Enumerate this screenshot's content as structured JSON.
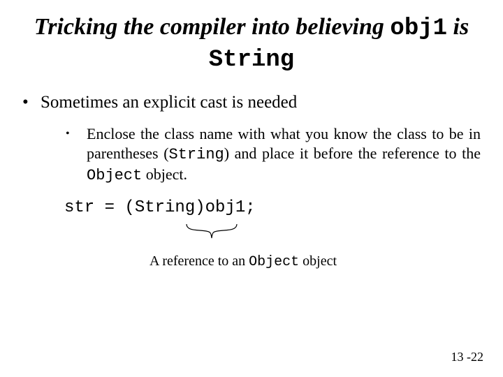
{
  "title": {
    "pre": "Tricking the compiler into believing ",
    "code1": "obj1",
    "mid": " is ",
    "code2": "String"
  },
  "point1": "Sometimes an explicit cast is needed",
  "sub1": {
    "a": "Enclose the class name with what you know the class to be in parentheses (",
    "code1": "String",
    "b": ") and place it before the reference to the ",
    "code2": "Object",
    "c": " object."
  },
  "code_line": "str = (String)obj1;",
  "annotation": {
    "a": "A reference to an ",
    "code": "Object",
    "b": " object"
  },
  "pagenum": "13 -22"
}
